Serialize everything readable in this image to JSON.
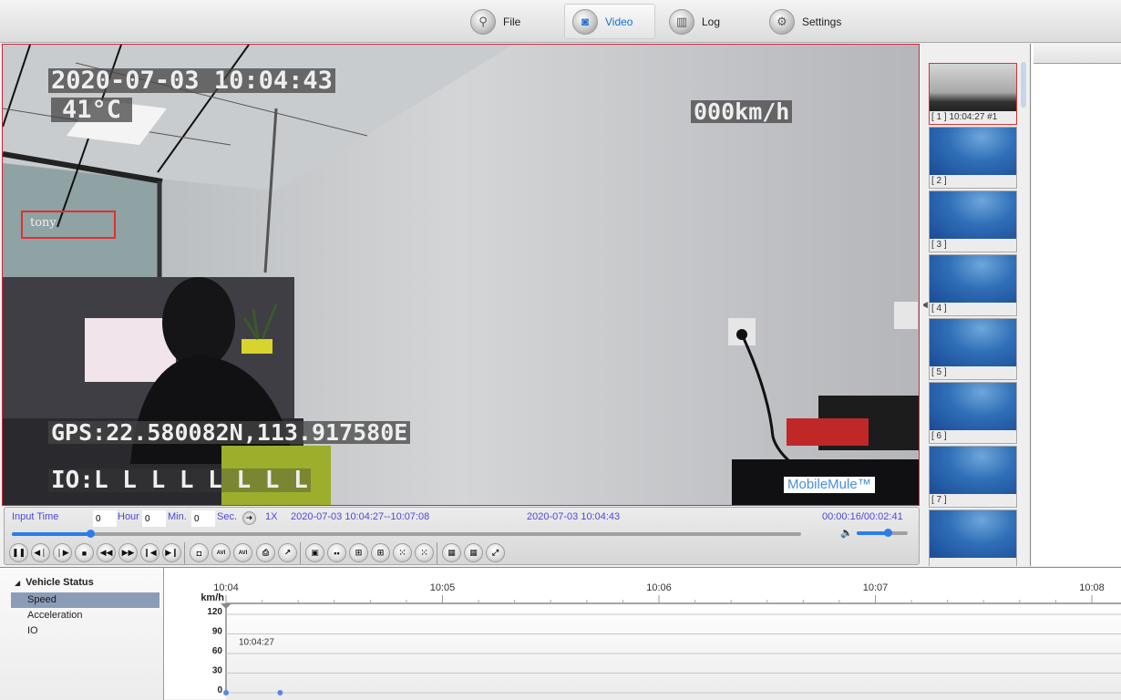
{
  "nav": {
    "items": [
      {
        "label": "File",
        "icon": "search-icon",
        "active": false
      },
      {
        "label": "Video",
        "icon": "camera-sync-icon",
        "active": true
      },
      {
        "label": "Log",
        "icon": "log-chart-icon",
        "active": false
      },
      {
        "label": "Settings",
        "icon": "settings-icon",
        "active": false
      }
    ]
  },
  "video": {
    "osd_datetime": "2020-07-03 10:04:43",
    "osd_temperature": "41°C",
    "osd_speed": "000km/h",
    "osd_gps": "GPS:22.580082N,113.917580E",
    "osd_io": "IO:L L L L L L L L",
    "face_label": "tony",
    "watermark": "MobileMule™"
  },
  "controls": {
    "input_time_label": "Input Time",
    "hour_value": "0",
    "hour_label": "Hour",
    "min_value": "0",
    "min_label": "Min.",
    "sec_value": "0",
    "sec_label": "Sec.",
    "speed": "1X",
    "time_range": "2020-07-03 10:04:27--10:07:08",
    "current_time": "2020-07-03 10:04:43",
    "elapsed": "00:00:16/00:02:41",
    "progress_fraction": 0.099,
    "volume_fraction": 0.6,
    "buttons": [
      {
        "name": "pause",
        "glyph": "❚❚"
      },
      {
        "name": "step-back",
        "glyph": "◀❘"
      },
      {
        "name": "step-forward",
        "glyph": "❘▶"
      },
      {
        "name": "stop",
        "glyph": "■"
      },
      {
        "name": "rewind",
        "glyph": "◀◀"
      },
      {
        "name": "fast-forward",
        "glyph": "▶▶"
      },
      {
        "name": "previous",
        "glyph": "❙◀"
      },
      {
        "name": "next",
        "glyph": "▶❙"
      },
      {
        "name": "snapshot",
        "glyph": "◘"
      },
      {
        "name": "record-avi",
        "glyph": "AVI"
      },
      {
        "name": "record-all-avi",
        "glyph": "AVI"
      },
      {
        "name": "print",
        "glyph": "⎙"
      },
      {
        "name": "chart",
        "glyph": "↗"
      },
      {
        "name": "layout-1",
        "glyph": "▣"
      },
      {
        "name": "layout-2",
        "glyph": "▪▪"
      },
      {
        "name": "layout-4",
        "glyph": "⊞"
      },
      {
        "name": "layout-6",
        "glyph": "⊞"
      },
      {
        "name": "layout-9",
        "glyph": "⁙"
      },
      {
        "name": "layout-12",
        "glyph": "⁙"
      },
      {
        "name": "layout-16",
        "glyph": "▦"
      },
      {
        "name": "layout-25",
        "glyph": "▦"
      },
      {
        "name": "fullscreen",
        "glyph": "⤢"
      }
    ]
  },
  "thumbnails": [
    {
      "label": "[ 1 ] 10:04:27 #1",
      "selected": true
    },
    {
      "label": "[ 2 ]",
      "selected": false
    },
    {
      "label": "[ 3 ]",
      "selected": false
    },
    {
      "label": "[ 4 ]",
      "selected": false
    },
    {
      "label": "[ 5 ]",
      "selected": false
    },
    {
      "label": "[ 6 ]",
      "selected": false
    },
    {
      "label": "[ 7 ]",
      "selected": false
    },
    {
      "label": "",
      "selected": false
    }
  ],
  "tree": {
    "root": "Vehicle Status",
    "items": [
      "Speed",
      "Acceleration",
      "IO"
    ],
    "selected": "Speed"
  },
  "chart_data": {
    "type": "line",
    "title": "",
    "ylabel": "km/h",
    "xlabel": "",
    "x_ticks": [
      "10:04",
      "10:05",
      "10:06",
      "10:07",
      "10:08"
    ],
    "y_ticks": [
      120,
      90,
      60,
      30,
      0
    ],
    "ylim": [
      0,
      120
    ],
    "cursor_label": "10:04:27",
    "series": [
      {
        "name": "Speed",
        "points": [
          {
            "x": "10:04:00",
            "y": 0
          },
          {
            "x": "10:04:15",
            "y": 0
          }
        ]
      }
    ],
    "grid": true
  }
}
